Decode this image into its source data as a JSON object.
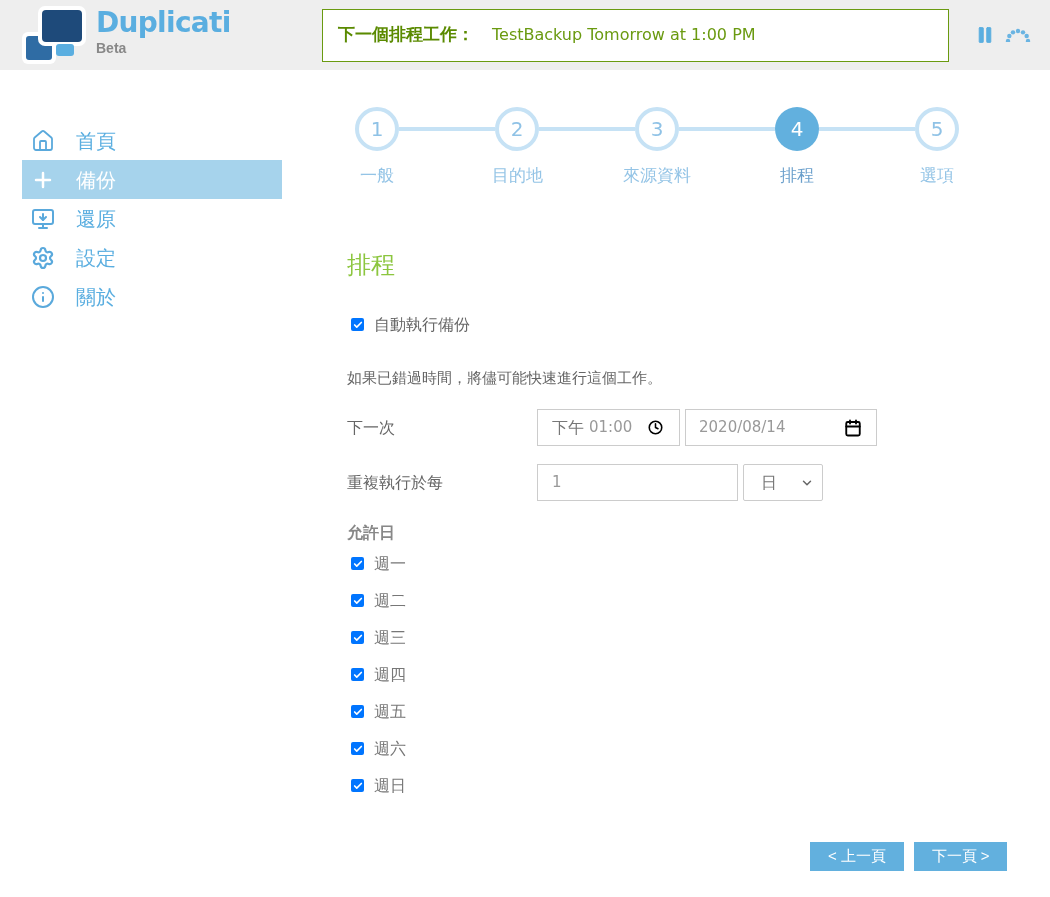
{
  "header": {
    "app_name": "Duplicati",
    "app_tag": "Beta",
    "banner_label": "下一個排程工作：",
    "banner_text": "TestBackup Tomorrow at 1:00 PM"
  },
  "sidebar": {
    "items": [
      {
        "kind": "home",
        "label": "首頁",
        "selected": false
      },
      {
        "kind": "add",
        "label": "備份",
        "selected": true
      },
      {
        "kind": "restore",
        "label": "還原",
        "selected": false
      },
      {
        "kind": "settings",
        "label": "設定",
        "selected": false
      },
      {
        "kind": "about",
        "label": "關於",
        "selected": false
      }
    ]
  },
  "steps": [
    {
      "number": "1",
      "label": "一般",
      "selected": false
    },
    {
      "number": "2",
      "label": "目的地",
      "selected": false
    },
    {
      "number": "3",
      "label": "來源資料",
      "selected": false
    },
    {
      "number": "4",
      "label": "排程",
      "selected": true
    },
    {
      "number": "5",
      "label": "選項",
      "selected": false
    }
  ],
  "form": {
    "title": "排程",
    "auto_run": {
      "label": "自動執行備份",
      "checked": true
    },
    "note": "如果已錯過時間，將儘可能快速進行這個工作。",
    "next": {
      "label": "下一次",
      "time_period": "下午",
      "time": "01:00",
      "date": "2020/08/14"
    },
    "repeat": {
      "label": "重複執行於每",
      "value": "1",
      "unit": "日"
    },
    "allowed_days_label": "允許日",
    "days": [
      {
        "label": "週一",
        "checked": true
      },
      {
        "label": "週二",
        "checked": true
      },
      {
        "label": "週三",
        "checked": true
      },
      {
        "label": "週四",
        "checked": true
      },
      {
        "label": "週五",
        "checked": true
      },
      {
        "label": "週六",
        "checked": true
      },
      {
        "label": "週日",
        "checked": true
      }
    ]
  },
  "buttons": {
    "previous": "< 上一頁",
    "next": "下一頁 >"
  }
}
